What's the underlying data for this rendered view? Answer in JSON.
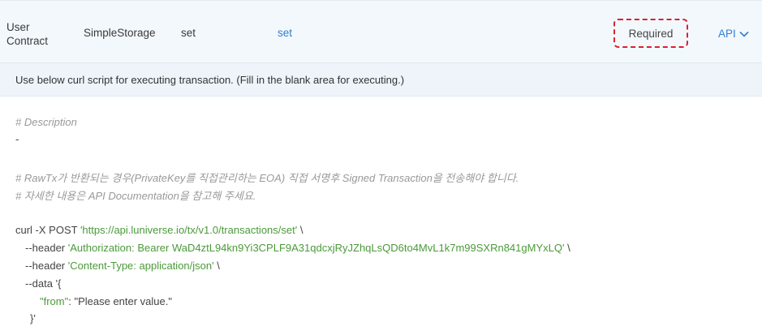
{
  "row": {
    "type_line1": "User",
    "type_line2": "Contract",
    "contract": "SimpleStorage",
    "function": "set",
    "function_link": "set",
    "status": "Required",
    "api_label": "API"
  },
  "info": {
    "text": "Use below curl script for executing transaction. (Fill in the blank area for executing.)"
  },
  "code": {
    "desc_comment": "# Description",
    "desc_value": "-",
    "note1": "# RawTx가 반환되는 경우(PrivateKey를 직접관리하는 EOA) 직접 서명후 Signed Transaction을 전송해야 합니다.",
    "note2": "# 자세한 내용은 API Documentation을 참고해 주세요.",
    "curl_cmd": "curl -X POST ",
    "curl_url": "'https://api.luniverse.io/tx/v1.0/transactions/set'",
    "backslash": " \\",
    "header_flag": "--header ",
    "auth_header": "'Authorization: Bearer WaD4ztL94kn9Yi3CPLF9A31qdcxjRyJZhqLsQD6to4MvL1k7m99SXRn841gMYxLQ'",
    "content_header": "'Content-Type: application/json'",
    "data_flag": "--data ",
    "data_open": "'{",
    "from_key": "\"from\"",
    "from_sep": ": ",
    "from_value": "\"Please enter value.\"",
    "data_close": "}'"
  },
  "colors": {
    "accent": "#2f7fd1",
    "required_border": "#d9232e",
    "string": "#4b9a3a",
    "comment": "#999999"
  }
}
